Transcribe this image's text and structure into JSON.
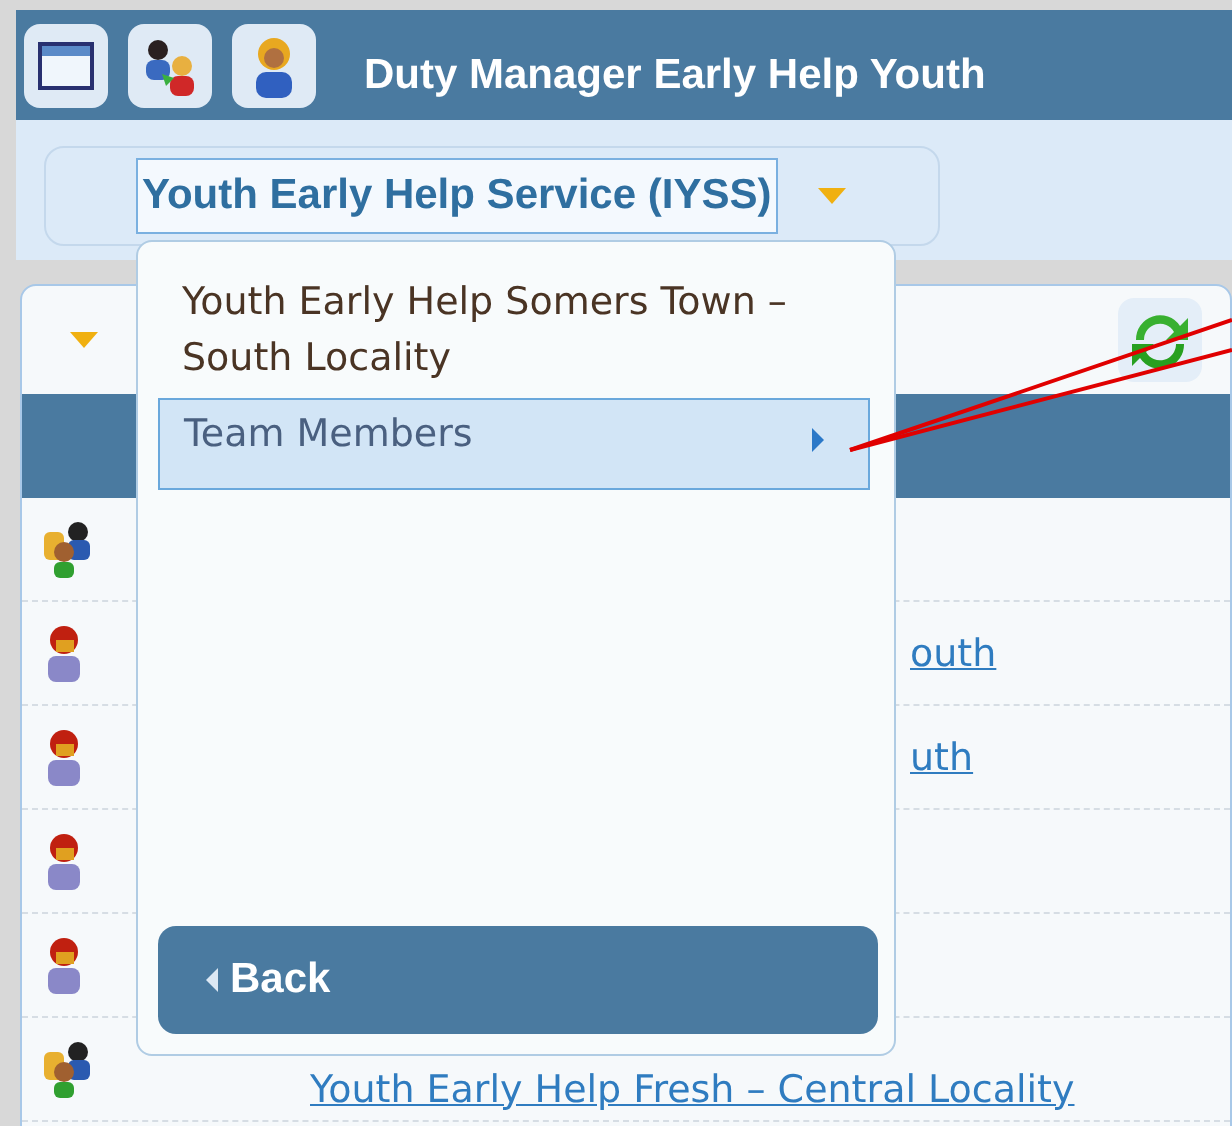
{
  "window": {
    "title": "Duty Manager Early Help Youth"
  },
  "toolbar_icons": [
    {
      "kind": "window"
    },
    {
      "kind": "switch-user"
    },
    {
      "kind": "user"
    }
  ],
  "service_select": {
    "value": "Youth Early Help Service (IYSS)"
  },
  "menu": {
    "heading": "Youth Early Help Somers Town – South Locality",
    "items": [
      {
        "label": "Team Members",
        "selected": true
      }
    ],
    "back": "Back"
  },
  "rows": [
    {
      "kind": "group",
      "link": ""
    },
    {
      "kind": "person",
      "link": "outh"
    },
    {
      "kind": "person",
      "link": "uth"
    },
    {
      "kind": "person",
      "link": ""
    },
    {
      "kind": "person",
      "link": ""
    },
    {
      "kind": "group",
      "link": "Youth Early Help Fresh – Central Locality"
    }
  ]
}
